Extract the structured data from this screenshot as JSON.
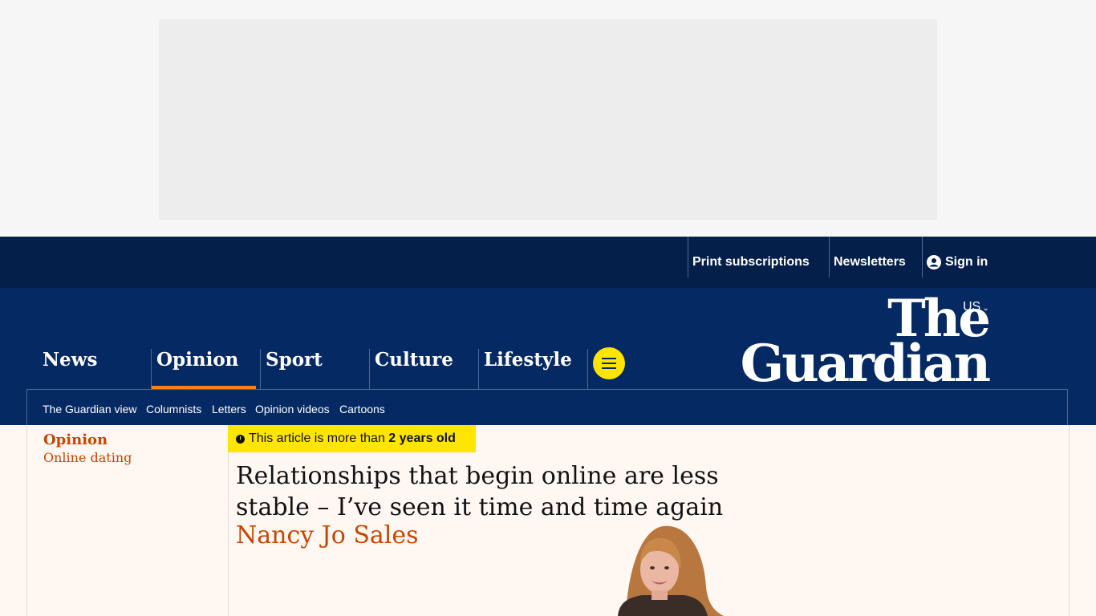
{
  "topbar": {
    "print_subscriptions": "Print subscriptions",
    "newsletters": "Newsletters",
    "sign_in": "Sign in"
  },
  "edition": "US",
  "logo": {
    "line1": "The",
    "line2": "Guardian"
  },
  "pillars": [
    "News",
    "Opinion",
    "Sport",
    "Culture",
    "Lifestyle"
  ],
  "active_pillar": "Opinion",
  "subnav": [
    "The Guardian view",
    "Columnists",
    "Letters",
    "Opinion videos",
    "Cartoons"
  ],
  "article": {
    "section": "Opinion",
    "series": "Online dating",
    "age_prefix": "This article is more than",
    "age_value": "2 years old",
    "headline": "Relationships that begin online are less stable – I’ve seen it time and time again",
    "byline": "Nancy Jo Sales"
  },
  "colors": {
    "brand_dark": "#041f4a",
    "brand": "#052962",
    "accent": "#ffe500",
    "opinion": "#c74600",
    "pillar_underline": "#ff7f0f"
  }
}
